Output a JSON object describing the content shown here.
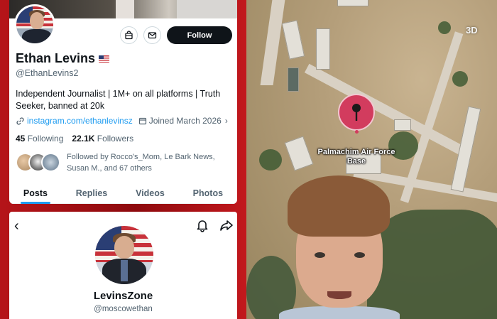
{
  "profile": {
    "name": "Ethan Levins",
    "handle": "@EthanLevins2",
    "bio": "Independent Journalist | 1M+ on all platforms | Truth Seeker, banned at 20k",
    "link": "instagram.com/ethanlevinsz",
    "joined": "Joined March 2026",
    "following_count": "45",
    "following_label": "Following",
    "followers_count": "22.1K",
    "followers_label": "Followers",
    "followed_by": "Followed by Rocco's_Mom, Le Bark News, Susan M., and 67 others",
    "follow_button": "Follow",
    "tabs": [
      "Posts",
      "Replies",
      "Videos",
      "Photos"
    ],
    "active_tab": "Posts"
  },
  "second_profile": {
    "name": "LevinsZone",
    "handle": "@moscowethan"
  },
  "map": {
    "mode_button": "3D",
    "pin_label": "Palmachim Air Force Base"
  },
  "icons": {
    "avatar": "profile-photo",
    "shop": "shopping-bag-icon",
    "message": "envelope-icon",
    "link": "link-icon",
    "calendar": "calendar-icon",
    "back": "back-arrow-icon",
    "notifications": "bell-icon",
    "share": "share-arrow-icon",
    "pin": "map-pin-icon"
  },
  "colors": {
    "accent": "#1d9bf0",
    "follow_button_bg": "#0f1419",
    "frame": "#b51419",
    "pin": "#d23c5e"
  }
}
